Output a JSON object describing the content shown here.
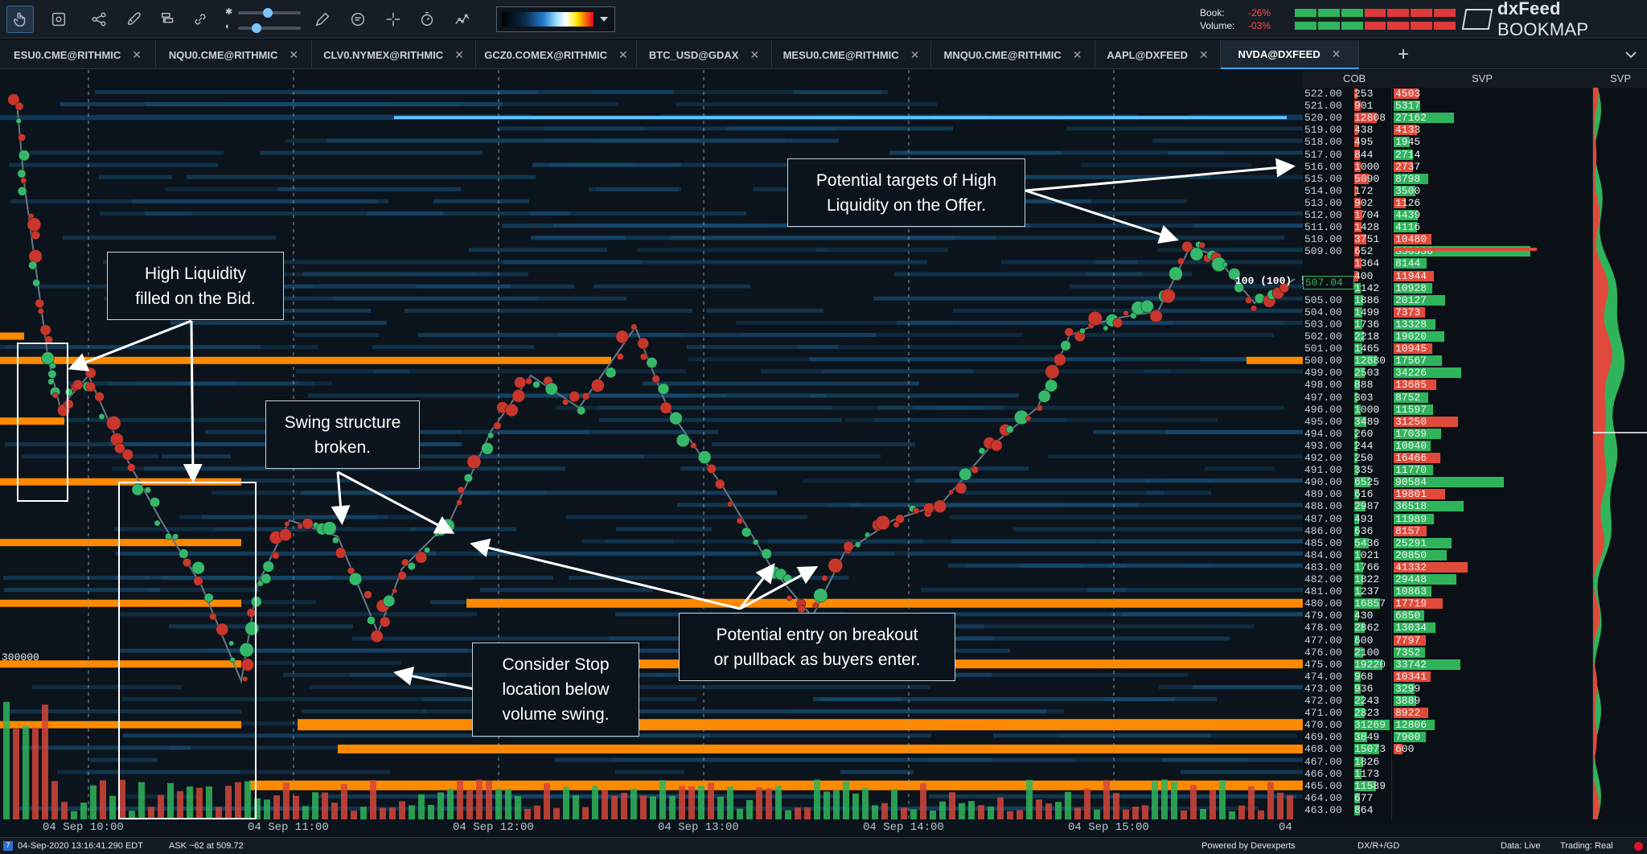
{
  "toolbar": {
    "tools": [
      "pointer-icon",
      "snapshot-icon",
      "share-icon",
      "rocket-icon",
      "layers-icon",
      "link-icon",
      "brightness-icon",
      "contrast-icon",
      "pencil-icon",
      "chat-icon",
      "crosshair-icon",
      "stopwatch-icon",
      "indicator-icon"
    ],
    "book_label": "Book:",
    "book_value": "-26%",
    "volume_label": "Volume:",
    "volume_value": "-03%"
  },
  "brand": {
    "name_bold": "dxFeed",
    "name_rest": " BOOKMAP"
  },
  "tabs": [
    {
      "label": "ESU0.CME@RITHMIC",
      "active": false
    },
    {
      "label": "NQU0.CME@RITHMIC",
      "active": false
    },
    {
      "label": "CLV0.NYMEX@RITHMIC",
      "active": false
    },
    {
      "label": "GCZ0.COMEX@RITHMIC",
      "active": false
    },
    {
      "label": "BTC_USD@GDAX",
      "active": false
    },
    {
      "label": "MESU0.CME@RITHMIC",
      "active": false
    },
    {
      "label": "MNQU0.CME@RITHMIC",
      "active": false
    },
    {
      "label": "AAPL@DXFEED",
      "active": false
    },
    {
      "label": "NVDA@DXFEED",
      "active": true
    }
  ],
  "panels": {
    "cob": "COB",
    "svp": "SVP",
    "svp2": "SVP"
  },
  "chart": {
    "volume_scale_label": "300000",
    "current_price": "507.04",
    "order_label": "100 (100)"
  },
  "ladder": [
    {
      "price": "522.00",
      "cob": "253",
      "side": "ask",
      "svp": "4503"
    },
    {
      "price": "521.00",
      "cob": "901",
      "side": "ask",
      "svp": "5317"
    },
    {
      "price": "520.00",
      "cob": "12808",
      "side": "ask",
      "svp": "27162"
    },
    {
      "price": "519.00",
      "cob": "438",
      "side": "ask",
      "svp": "4133"
    },
    {
      "price": "518.00",
      "cob": "495",
      "side": "ask",
      "svp": "1945"
    },
    {
      "price": "517.00",
      "cob": "844",
      "side": "ask",
      "svp": "2714"
    },
    {
      "price": "516.00",
      "cob": "1000",
      "side": "ask",
      "svp": "2737"
    },
    {
      "price": "515.00",
      "cob": "5090",
      "side": "ask",
      "svp": "8798"
    },
    {
      "price": "514.00",
      "cob": "172",
      "side": "ask",
      "svp": "3500"
    },
    {
      "price": "513.00",
      "cob": "902",
      "side": "ask",
      "svp": "1126"
    },
    {
      "price": "512.00",
      "cob": "1704",
      "side": "ask",
      "svp": "4439"
    },
    {
      "price": "511.00",
      "cob": "1428",
      "side": "ask",
      "svp": "4116"
    },
    {
      "price": "510.00",
      "cob": "3751",
      "side": "ask",
      "svp": "10480"
    },
    {
      "price": "509.00",
      "cob": "652",
      "side": "ask",
      "svp": "330336"
    },
    {
      "price": "",
      "cob": "1364",
      "side": "ask",
      "svp": "8144"
    },
    {
      "price": "",
      "cob": "400",
      "side": "ask",
      "svp": "11944"
    },
    {
      "price": "",
      "cob": "1142",
      "side": "bid",
      "svp": "10928"
    },
    {
      "price": "505.00",
      "cob": "1886",
      "side": "bid",
      "svp": "20127"
    },
    {
      "price": "504.00",
      "cob": "1499",
      "side": "bid",
      "svp": "7373"
    },
    {
      "price": "503.00",
      "cob": "1736",
      "side": "bid",
      "svp": "13328"
    },
    {
      "price": "502.00",
      "cob": "2218",
      "side": "bid",
      "svp": "19020"
    },
    {
      "price": "501.00",
      "cob": "1465",
      "side": "bid",
      "svp": "10945"
    },
    {
      "price": "500.00",
      "cob": "12880",
      "side": "bid",
      "svp": "17567"
    },
    {
      "price": "499.00",
      "cob": "2503",
      "side": "bid",
      "svp": "34226"
    },
    {
      "price": "498.00",
      "cob": "888",
      "side": "bid",
      "svp": "13685"
    },
    {
      "price": "497.00",
      "cob": "303",
      "side": "bid",
      "svp": "8752"
    },
    {
      "price": "496.00",
      "cob": "1000",
      "side": "bid",
      "svp": "11597"
    },
    {
      "price": "495.00",
      "cob": "3489",
      "side": "bid",
      "svp": "31250"
    },
    {
      "price": "494.00",
      "cob": "260",
      "side": "bid",
      "svp": "17039"
    },
    {
      "price": "493.00",
      "cob": "244",
      "side": "bid",
      "svp": "10040"
    },
    {
      "price": "492.00",
      "cob": "250",
      "side": "bid",
      "svp": "16466"
    },
    {
      "price": "491.00",
      "cob": "335",
      "side": "bid",
      "svp": "11770"
    },
    {
      "price": "490.00",
      "cob": "6525",
      "side": "bid",
      "svp": "90584"
    },
    {
      "price": "489.00",
      "cob": "616",
      "side": "bid",
      "svp": "19801"
    },
    {
      "price": "488.00",
      "cob": "2987",
      "side": "bid",
      "svp": "36518"
    },
    {
      "price": "487.00",
      "cob": "493",
      "side": "bid",
      "svp": "11989"
    },
    {
      "price": "486.00",
      "cob": "636",
      "side": "bid",
      "svp": "8157"
    },
    {
      "price": "485.00",
      "cob": "5436",
      "side": "bid",
      "svp": "25291"
    },
    {
      "price": "484.00",
      "cob": "1021",
      "side": "bid",
      "svp": "20850"
    },
    {
      "price": "483.00",
      "cob": "1766",
      "side": "bid",
      "svp": "41332"
    },
    {
      "price": "482.00",
      "cob": "1822",
      "side": "bid",
      "svp": "29448"
    },
    {
      "price": "481.00",
      "cob": "1237",
      "side": "bid",
      "svp": "10863"
    },
    {
      "price": "480.00",
      "cob": "16857",
      "side": "bid",
      "svp": "17719"
    },
    {
      "price": "479.00",
      "cob": "430",
      "side": "bid",
      "svp": "6850"
    },
    {
      "price": "478.00",
      "cob": "2862",
      "side": "bid",
      "svp": "13034"
    },
    {
      "price": "477.00",
      "cob": "600",
      "side": "bid",
      "svp": "7797"
    },
    {
      "price": "476.00",
      "cob": "2100",
      "side": "bid",
      "svp": "7352"
    },
    {
      "price": "475.00",
      "cob": "19220",
      "side": "bid",
      "svp": "33742"
    },
    {
      "price": "474.00",
      "cob": "968",
      "side": "bid",
      "svp": "10341"
    },
    {
      "price": "473.00",
      "cob": "936",
      "side": "bid",
      "svp": "3299"
    },
    {
      "price": "472.00",
      "cob": "2243",
      "side": "bid",
      "svp": "3889"
    },
    {
      "price": "471.00",
      "cob": "2823",
      "side": "bid",
      "svp": "8922"
    },
    {
      "price": "470.00",
      "cob": "31269",
      "side": "bid",
      "svp": "12806"
    },
    {
      "price": "469.00",
      "cob": "3849",
      "side": "bid",
      "svp": "7900"
    },
    {
      "price": "468.00",
      "cob": "15073",
      "side": "bid",
      "svp": "600"
    },
    {
      "price": "467.00",
      "cob": "1826",
      "side": "bid",
      "svp": ""
    },
    {
      "price": "466.00",
      "cob": "1173",
      "side": "bid",
      "svp": ""
    },
    {
      "price": "465.00",
      "cob": "11589",
      "side": "bid",
      "svp": ""
    },
    {
      "price": "464.00",
      "cob": "677",
      "side": "bid",
      "svp": ""
    },
    {
      "price": "463.00",
      "cob": "864",
      "side": "bid",
      "svp": ""
    }
  ],
  "time_axis": [
    "04 Sep 10:00",
    "04 Sep 11:00",
    "04 Sep 12:00",
    "04 Sep 13:00",
    "04 Sep 14:00",
    "04 Sep 15:00",
    "04"
  ],
  "annotations": {
    "high_liquidity_bid": [
      "High Liquidity",
      "filled on the Bid."
    ],
    "swing_broken": [
      "Swing structure",
      "broken."
    ],
    "stop_location": [
      "Consider Stop",
      "location below",
      "volume swing."
    ],
    "entry": [
      "Potential entry on breakout",
      "or pullback as buyers enter."
    ],
    "targets": [
      "Potential targets of High",
      "Liquidity on the Offer."
    ]
  },
  "status": {
    "datetime": "04-Sep-2020 13:16:41.290 EDT",
    "ask": "ASK ~62 at 509.72",
    "powered": "Powered by Devexperts",
    "feed": "DX/R+/GD",
    "data": "Data: Live",
    "trading": "Trading: Real"
  },
  "colors": {
    "bid": "#35b86a",
    "ask": "#e04a3a",
    "liquidity": "#ff8a00",
    "heatmap_base": "#0b141c",
    "accent": "#3ea0ff"
  }
}
